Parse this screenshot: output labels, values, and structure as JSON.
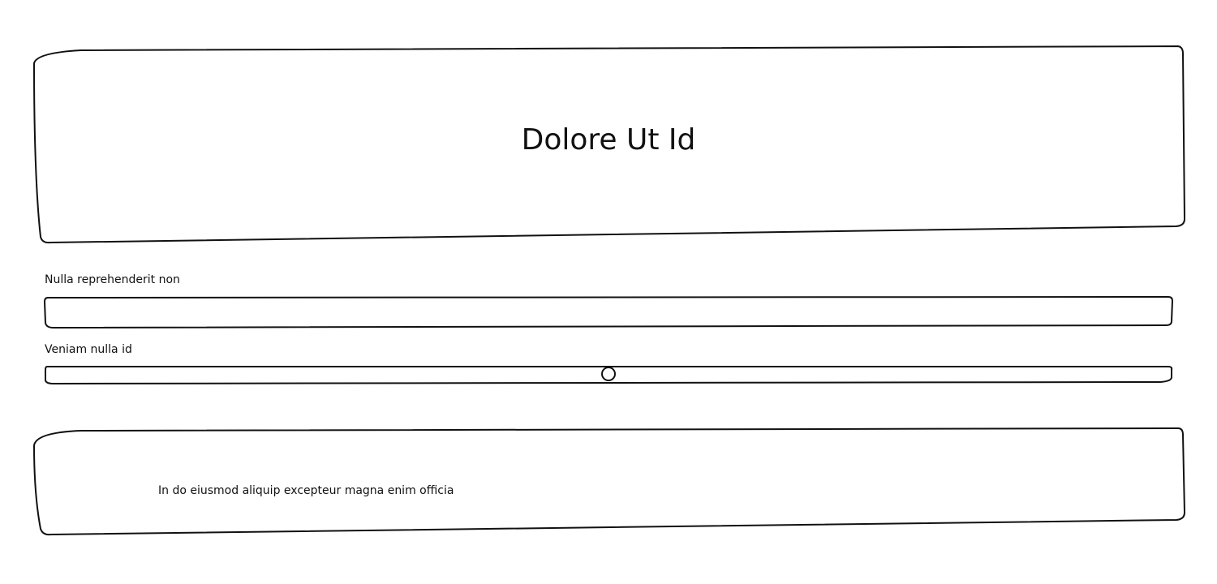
{
  "hero": {
    "title": "Dolore Ut Id"
  },
  "form": {
    "text_field": {
      "label": "Nulla reprehenderit non",
      "value": "",
      "placeholder": ""
    },
    "slider": {
      "label": "Veniam nulla id",
      "value_fraction": 0.5
    }
  },
  "footer": {
    "text": "In do eiusmod aliquip excepteur magna enim officia"
  }
}
